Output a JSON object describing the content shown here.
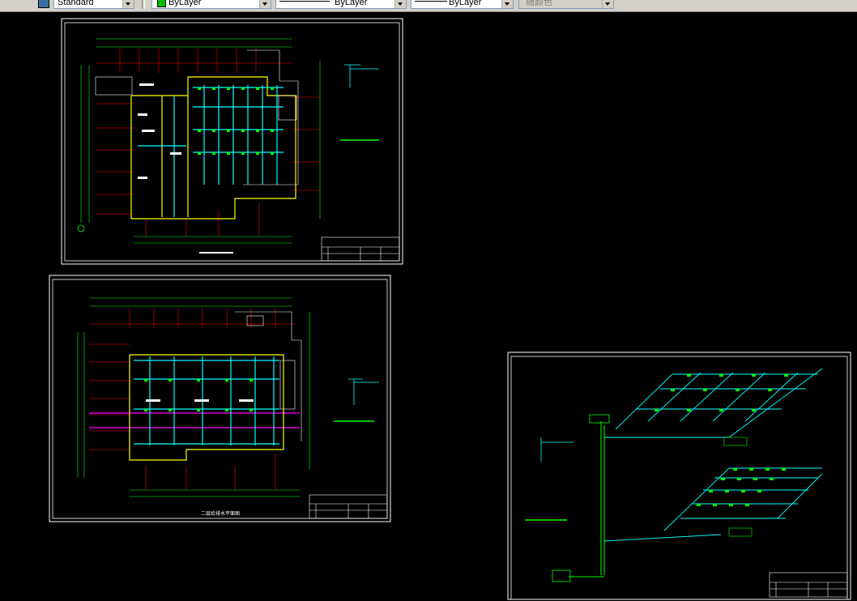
{
  "toolbar": {
    "text_style": "Standard",
    "layer_color": "ByLayer",
    "color_swatch": "#00c000",
    "linetype": "ByLayer",
    "lineweight": "ByLayer",
    "plot_style": "随颜色"
  },
  "sheets": {
    "sheet1": {
      "name": "floor-plan-1"
    },
    "sheet2": {
      "name": "floor-plan-2",
      "caption": "二层给排水平面图"
    },
    "sheet3": {
      "name": "isometric-sprinkler"
    }
  },
  "colors": {
    "background": "#000000",
    "border": "#ffffff",
    "grid": "#00ff00",
    "walls": "#ffff00",
    "pipes": "#00ffff",
    "axis_lines": "#ff0000",
    "drain": "#ff00ff"
  }
}
